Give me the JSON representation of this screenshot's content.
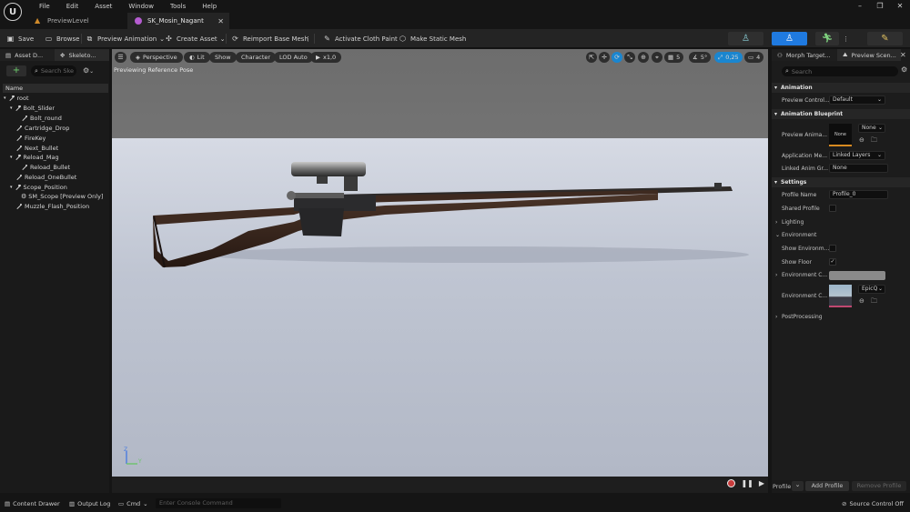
{
  "menu": [
    "File",
    "Edit",
    "Asset",
    "Window",
    "Tools",
    "Help"
  ],
  "tabs": [
    {
      "label": "PreviewLevel",
      "active": false
    },
    {
      "label": "SK_Mosin_Nagant",
      "active": true
    }
  ],
  "toolbar": {
    "save": "Save",
    "browse": "Browse",
    "preview_animation": "Preview Animation",
    "create_asset": "Create Asset",
    "reimport": "Reimport Base Mesh",
    "cloth_paint": "Activate Cloth Paint",
    "static_mesh": "Make Static Mesh"
  },
  "left_panel": {
    "tab1": "Asset D...",
    "tab2": "Skeleto...",
    "search_placeholder": "Search Ske",
    "column_name": "Name",
    "bones": [
      "root",
      "Bolt_Slider",
      "Bolt_round",
      "Cartridge_Drop",
      "FireKey",
      "Next_Bullet",
      "Reload_Mag",
      "Reload_Bullet",
      "Reload_OneBullet",
      "Scope_Position",
      "SM_Scope [Preview Only]",
      "Muzzle_Flash_Position"
    ]
  },
  "viewport": {
    "perspective": "Perspective",
    "lit": "Lit",
    "show": "Show",
    "character": "Character",
    "lod": "LOD Auto",
    "speed": "x1,0",
    "grid": "5",
    "angle": "5°",
    "scale": "0,25",
    "cam": "4",
    "caption": "Previewing Reference Pose",
    "axis_z": "Z",
    "axis_y": "Y"
  },
  "right_panel": {
    "tab1": "Morph Target...",
    "tab2": "Preview Scen...",
    "search_placeholder": "Search",
    "sections": {
      "animation": "Animation",
      "anim_blueprint": "Animation Blueprint",
      "settings": "Settings"
    },
    "preview_controller_label": "Preview Control...",
    "preview_controller_value": "Default",
    "preview_anim_label": "Preview Anima...",
    "preview_anim_thumb": "None",
    "preview_anim_value": "None",
    "app_method_label": "Application Me...",
    "app_method_value": "Linked Layers",
    "linked_anim_label": "Linked Anim Gr...",
    "linked_anim_value": "None",
    "profile_name_label": "Profile Name",
    "profile_name_value": "Profile_0",
    "shared_profile_label": "Shared Profile",
    "lighting": "Lighting",
    "environment": "Environment",
    "show_env_label": "Show Environm...",
    "show_floor_label": "Show Floor",
    "env_color_label": "Environment C...",
    "env_cube_label": "Environment C...",
    "env_cube_value": "EpicQ",
    "postprocessing": "PostProcessing",
    "profile_label": "Profile",
    "add_profile": "Add Profile",
    "remove_profile": "Remove Profile"
  },
  "statusbar": {
    "content_drawer": "Content Drawer",
    "output_log": "Output Log",
    "cmd": "Cmd",
    "console_placeholder": "Enter Console Command",
    "source_control": "Source Control Off"
  },
  "colors": {
    "accent": "#1f7ae0",
    "selection": "#1a86d0"
  }
}
